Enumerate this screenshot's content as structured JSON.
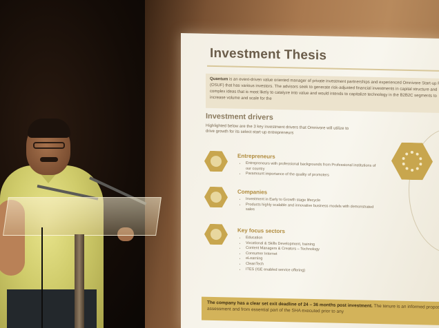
{
  "slide": {
    "title": "Investment Thesis",
    "intro_lead": "Quantum",
    "intro_text": "is an event-driven value oriented manager of private investment partnerships and experienced Omnivore Start-up Fund (OSUF) that has various investors. The advisors seek to generate risk-adjusted financial investments in capital structure and complex ideas that is most likely to catalyze into value and would intends to capitalize technology in the B2B2C segments to increase volume and scale for the",
    "drivers_heading": "Investment drivers",
    "drivers_text": "Highlighted below are the 3 key investment drivers that Omnivore will utilize to drive growth for its select start-up entrepreneurs",
    "sections": [
      {
        "heading": "Entrepreneurs",
        "items": [
          "Entrepreneurs with professional backgrounds from Professional institutions of our country",
          "Paramount importance of the quality of promoters"
        ]
      },
      {
        "heading": "Companies",
        "items": [
          "Investment in Early to Growth stage lifecycle",
          "Products highly scalable and innovative business models with demonstrated sales"
        ]
      },
      {
        "heading": "Key focus sectors",
        "items": [
          "Education",
          "Vocational & Skills Development, training",
          "Content Managers & Creators – Technology",
          "Consumer Internet",
          "eLearning",
          "CleanTech",
          "ITES (ISE enabled service offering)"
        ]
      }
    ],
    "footer_lead": "The company has a clear set exit deadline of 24 – 36 months post investment.",
    "footer_text": "The tenure is an informed proposal assessment and from essential part of the SHA executed prior to any"
  }
}
